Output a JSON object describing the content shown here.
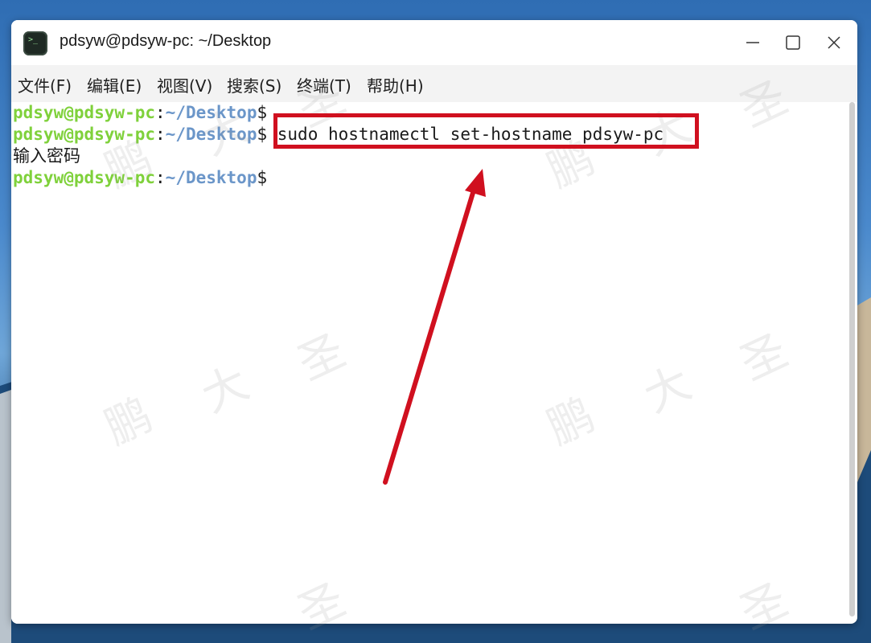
{
  "window": {
    "title": "pdsyw@pdsyw-pc: ~/Desktop",
    "icon": "terminal-icon"
  },
  "menu": {
    "items": [
      {
        "label": "文件(F)"
      },
      {
        "label": "编辑(E)"
      },
      {
        "label": "视图(V)"
      },
      {
        "label": "搜索(S)"
      },
      {
        "label": "终端(T)"
      },
      {
        "label": "帮助(H)"
      }
    ]
  },
  "terminal": {
    "prompt_user": "pdsyw@pdsyw-pc",
    "prompt_colon": ":",
    "prompt_path": "~/Desktop",
    "prompt_dollar": "$",
    "lines": [
      {
        "command": ""
      },
      {
        "command": " sudo hostnamectl set-hostname pdsyw-pc"
      },
      {
        "output": "输入密码"
      },
      {
        "command": ""
      }
    ]
  },
  "watermark": {
    "chars": [
      "鹏",
      "大",
      "圣"
    ]
  },
  "colors": {
    "prompt_user": "#7fd13b",
    "prompt_path": "#6b96c9",
    "highlight": "#d0101f"
  }
}
